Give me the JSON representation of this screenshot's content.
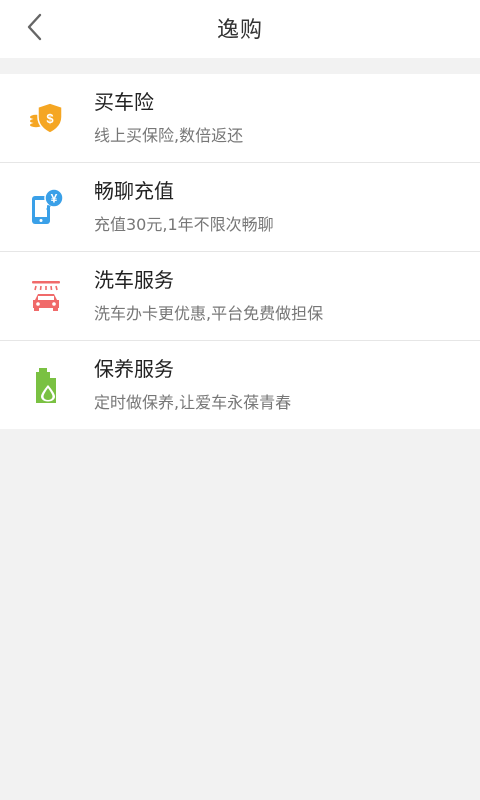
{
  "header": {
    "title": "逸购"
  },
  "items": [
    {
      "title": "买车险",
      "desc": "线上买保险,数倍返还",
      "icon": "insurance-shield-icon",
      "color": "#f5a623"
    },
    {
      "title": "畅聊充值",
      "desc": "充值30元,1年不限次畅聊",
      "icon": "phone-recharge-icon",
      "color": "#3aa0e8"
    },
    {
      "title": "洗车服务",
      "desc": "洗车办卡更优惠,平台免费做担保",
      "icon": "car-wash-icon",
      "color": "#f06a6a"
    },
    {
      "title": "保养服务",
      "desc": "定时做保养,让爱车永葆青春",
      "icon": "oil-maintenance-icon",
      "color": "#7ac142"
    }
  ]
}
